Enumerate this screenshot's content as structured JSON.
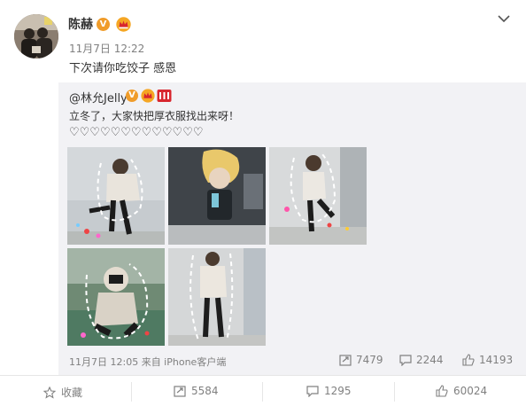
{
  "post": {
    "author": "陈赫",
    "verified_badge": "V",
    "time": "11月7日 12:22",
    "text": "下次请你吃饺子 感恩",
    "icons": [
      "avatar",
      "verified-badge",
      "crown-icon",
      "chevron-down-icon"
    ]
  },
  "repost": {
    "author": "@林允Jelly",
    "verified_badge": "V",
    "text": "立冬了，大家快把厚衣服找出来呀！",
    "hearts": "♡♡♡♡♡♡♡♡♡♡♡♡♡",
    "photo_count": 5,
    "meta": "11月7日 12:05 来自 iPhone客户端",
    "actions": {
      "repost_count": "7479",
      "comment_count": "2244",
      "like_count": "14193"
    }
  },
  "bottom_bar": {
    "favorite_label": "收藏",
    "repost_count": "5584",
    "comment_count": "1295",
    "like_count": "60024"
  },
  "colors": {
    "repost_bg": "#f2f2f5",
    "muted_text": "#808080",
    "badge_orange": "#f09c2a",
    "badge_red": "#d8262e"
  }
}
